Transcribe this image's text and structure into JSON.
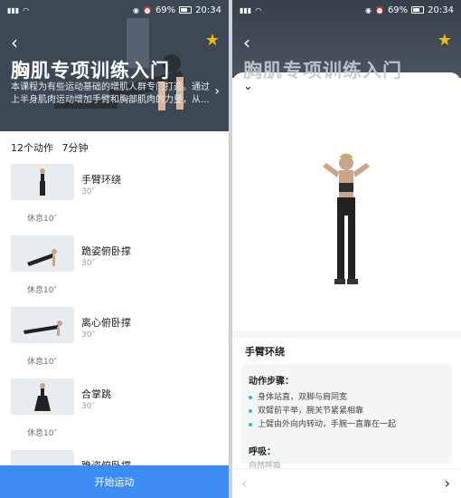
{
  "status_bar": {
    "battery": "69%",
    "time": "20:34"
  },
  "course": {
    "title": "胸肌专项训练入门",
    "description": "本课程为有些运动基础的增肌人群专门打造。通过上半身肌肉运动增加手臂和胸部肌肉的力量，从...",
    "count": "12个动作",
    "duration": "7分钟"
  },
  "exercises": [
    {
      "name": "手臂环绕",
      "duration": "30″",
      "rest": "休息10″"
    },
    {
      "name": "跪姿俯卧撑",
      "duration": "30″",
      "rest": "休息10″"
    },
    {
      "name": "离心俯卧撑",
      "duration": "30″",
      "rest": "休息10″"
    },
    {
      "name": "合掌跳",
      "duration": "30″",
      "rest": "休息10″"
    },
    {
      "name": "跪姿俯卧撑",
      "duration": "",
      "rest": ""
    }
  ],
  "start_button": "开始运动",
  "detail": {
    "name": "手臂环绕",
    "steps_title": "动作步骤：",
    "steps": [
      "身体站直，双脚与肩同宽",
      "双臂前平举，腕关节紧紧相靠",
      "上臂由外向内转动，手腕一直靠在一起"
    ],
    "breath_title": "呼吸：",
    "breath_text": "自然呼吸"
  },
  "colors": {
    "accent": "#3d8cf3",
    "star": "#f2b619",
    "step_bullet": "#38b5c9"
  },
  "icons": {
    "back": "chevron-left-icon",
    "favorite": "star-icon",
    "collapse": "chevron-down-icon",
    "prev": "chevron-left-icon",
    "next": "chevron-right-icon"
  }
}
